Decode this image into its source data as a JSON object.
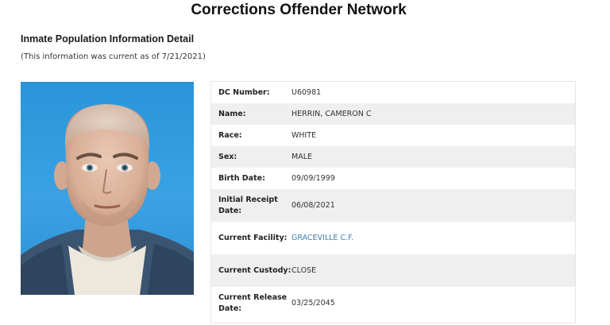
{
  "header": {
    "site_title": "Corrections Offender Network"
  },
  "section": {
    "title": "Inmate Population Information Detail",
    "current_note": "(This information was current as of 7/21/2021)"
  },
  "photo": {
    "background_color": "#2a95d9",
    "description": "inmate-photo"
  },
  "details": {
    "rows": [
      {
        "label": "DC Number:",
        "value": "U60981"
      },
      {
        "label": "Name:",
        "value": "HERRIN, CAMERON C"
      },
      {
        "label": "Race:",
        "value": "WHITE"
      },
      {
        "label": "Sex:",
        "value": "MALE"
      },
      {
        "label": "Birth Date:",
        "value": "09/09/1999"
      },
      {
        "label": "Initial Receipt Date:",
        "value": "06/08/2021"
      },
      {
        "label": "Current Facility:",
        "value": "GRACEVILLE C.F."
      },
      {
        "label": "Current Custody:",
        "value": "CLOSE"
      },
      {
        "label": "Current Release Date:",
        "value": "03/25/2045"
      }
    ]
  },
  "colors": {
    "link": "#3f7fb0",
    "row_alt": "#efefef"
  }
}
